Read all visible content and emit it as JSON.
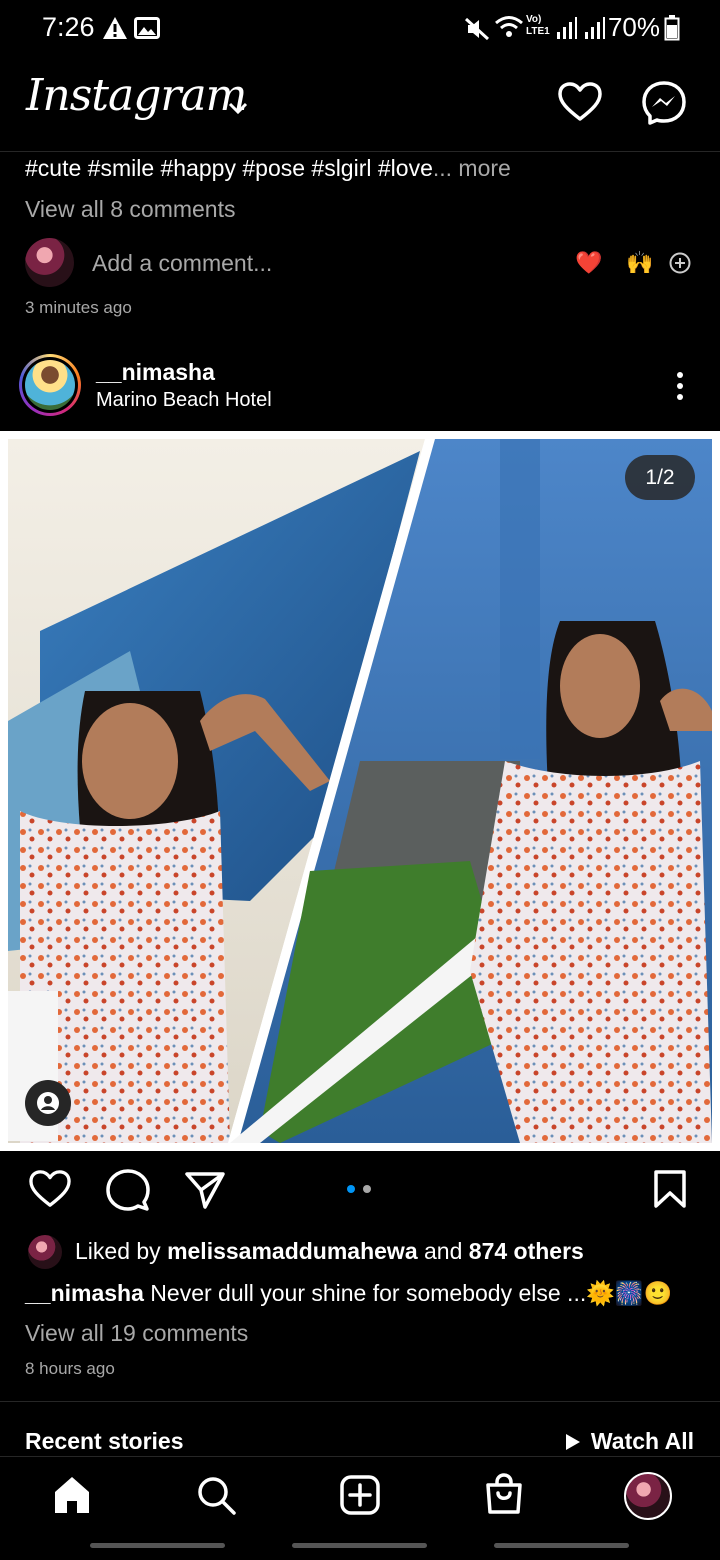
{
  "status_bar": {
    "time": "7:26",
    "battery": "70%",
    "network": "Vo) LTE1"
  },
  "header": {
    "logo": "Instagram",
    "icons": [
      "chevron-down-icon",
      "heart-icon",
      "messenger-icon"
    ]
  },
  "previous_post": {
    "hashtags": "#cute #smile #happy #pose #slgirl #love",
    "more": "... more",
    "view_comments": "View all 8 comments",
    "add_comment_placeholder": "Add a comment...",
    "quick_reactions": [
      "❤️",
      "🙌"
    ],
    "time_ago": "3 minutes ago"
  },
  "post": {
    "username": "__nimasha",
    "location": "Marino Beach Hotel",
    "image_counter": "1/2",
    "liked_by_prefix": "Liked by ",
    "liked_by_user": "melissamaddumahewa",
    "liked_by_and": " and ",
    "liked_by_others": "874 others",
    "caption_user": "__nimasha",
    "caption_text": " Never dull your shine for somebody else ...🌞🎆🙂",
    "view_comments": "View all 19 comments",
    "time_ago": "8 hours ago"
  },
  "recent_stories": {
    "title": "Recent stories",
    "watch_all": "Watch All"
  },
  "bottom_nav": [
    "home-icon",
    "search-icon",
    "create-icon",
    "shop-icon",
    "profile-avatar"
  ],
  "colors": {
    "background": "#000000",
    "secondary_text": "#a8a8a8",
    "accent_blue": "#0095f6",
    "heart_red": "#ed4956"
  }
}
